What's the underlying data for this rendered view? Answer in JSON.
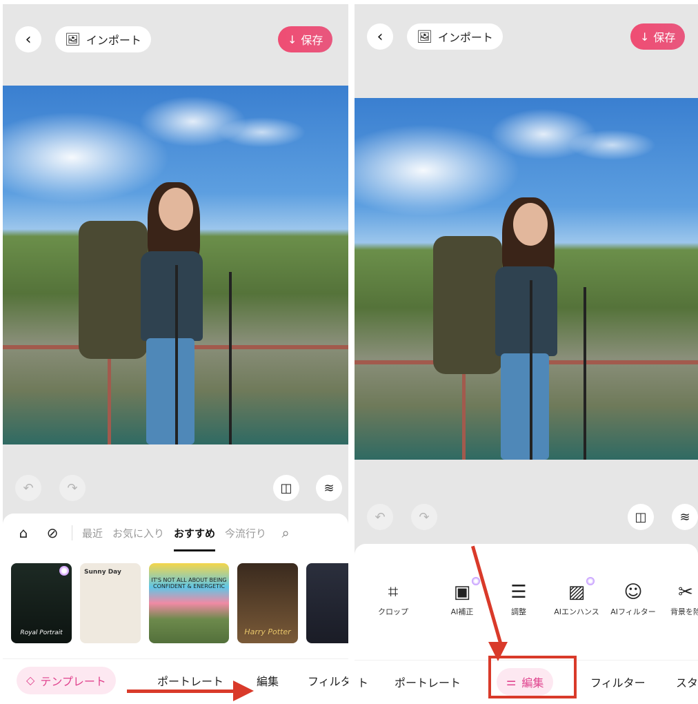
{
  "left": {
    "import_label": "インポート",
    "save_label": "保存",
    "categories": [
      "最近",
      "お気に入り",
      "おすすめ",
      "今流行り"
    ],
    "thumbs": [
      {
        "caption": "Royal Portrait"
      },
      {
        "caption": "Sunny Day"
      },
      {
        "caption": "IT'S NOT ALL ABOUT BEING CONFIDENT & ENERGETIC"
      },
      {
        "caption": "Harry Potter"
      },
      {
        "caption": ""
      }
    ],
    "nav": [
      "テンプレート",
      "ポートレート",
      "編集",
      "フィルタ"
    ]
  },
  "right": {
    "import_label": "インポート",
    "save_label": "保存",
    "tools": [
      "クロップ",
      "AI補正",
      "調整",
      "AIエンハンス",
      "AIフィルター",
      "背景を除"
    ],
    "nav": [
      "ト",
      "ポートレート",
      "編集",
      "フィルター",
      "スタ"
    ]
  },
  "icons": {
    "back": "chevron-left-icon",
    "import": "image-import-icon",
    "save": "arrow-down-icon",
    "undo": "undo-icon",
    "redo": "redo-icon",
    "compare": "compare-icon",
    "layers": "layers-icon"
  },
  "colors": {
    "accent": "#e0448e",
    "save_gradient_start": "#ef4d73",
    "annotation_red": "#d93a2a"
  }
}
